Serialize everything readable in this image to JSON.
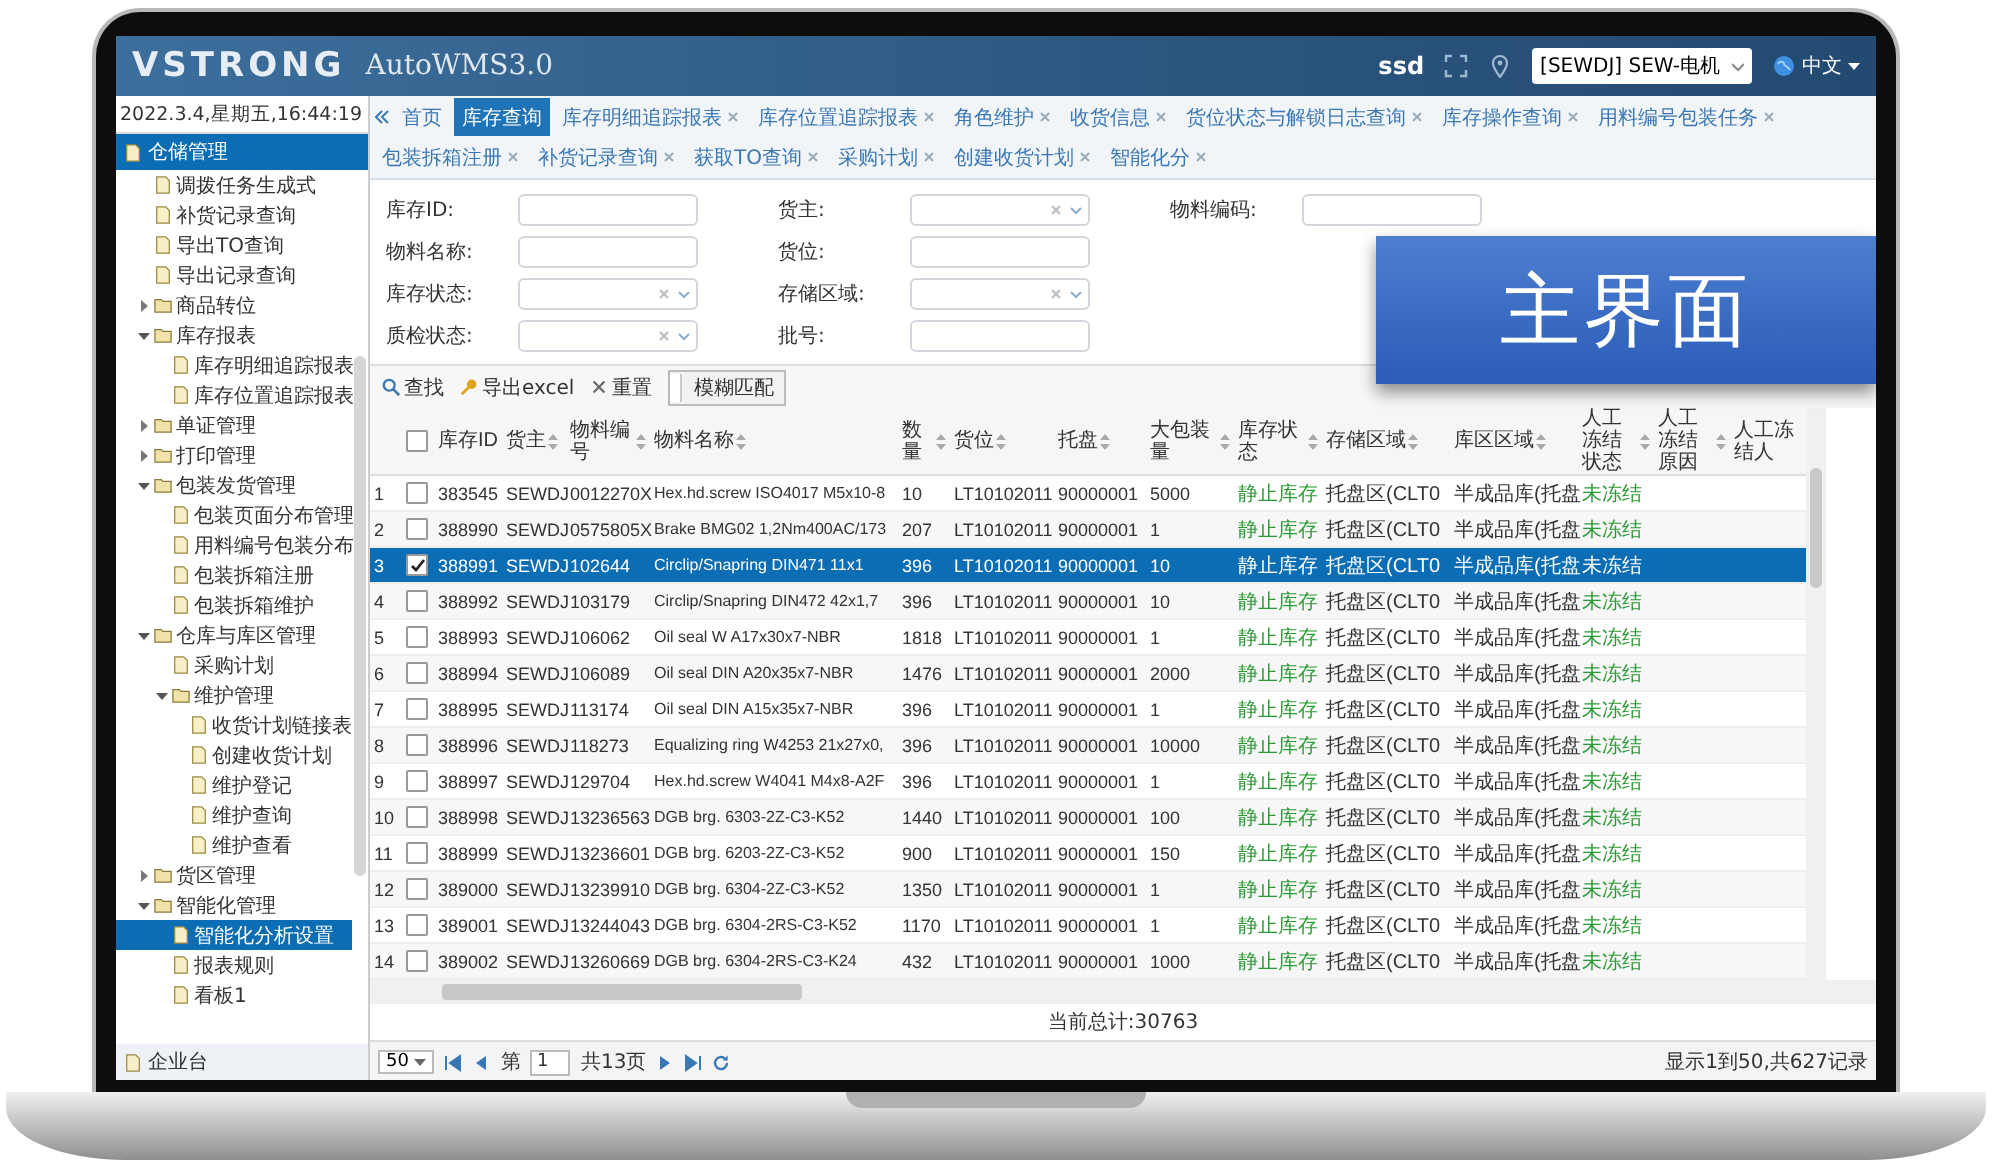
{
  "header": {
    "logo": "VSTRONG",
    "title": "AutoWMS3.0",
    "user": "ssd",
    "warehouse": "[SEWDJ] SEW-电机",
    "language": "中文"
  },
  "sidebar": {
    "datetime": "2022.3.4,星期五,16:44:19",
    "sections": [
      {
        "label": "仓储管理",
        "expanded": true,
        "items": [
          {
            "label": "调拨任务生成式",
            "kind": "leaf",
            "selected": false
          },
          {
            "label": "补货记录查询",
            "kind": "leaf",
            "selected": false
          },
          {
            "label": "导出TO查询",
            "kind": "leaf",
            "selected": false
          },
          {
            "label": "导出记录查询",
            "kind": "leaf",
            "selected": false
          },
          {
            "label": "商品转位",
            "kind": "group",
            "expanded": false,
            "selected": false
          },
          {
            "label": "库存报表",
            "kind": "group",
            "expanded": true,
            "selected": false,
            "children": [
              {
                "label": "库存明细追踪报表",
                "kind": "leaf",
                "selected": false
              },
              {
                "label": "库存位置追踪报表",
                "kind": "leaf",
                "selected": false
              }
            ]
          },
          {
            "label": "单证管理",
            "kind": "group",
            "expanded": false,
            "selected": false
          },
          {
            "label": "打印管理",
            "kind": "group",
            "expanded": false,
            "selected": false
          },
          {
            "label": "包装发货管理",
            "kind": "group",
            "expanded": true,
            "selected": false,
            "children": [
              {
                "label": "包装页面分布管理",
                "kind": "leaf",
                "selected": false
              },
              {
                "label": "用料编号包装分布",
                "kind": "leaf",
                "selected": false
              },
              {
                "label": "包装拆箱注册",
                "kind": "leaf",
                "selected": false
              },
              {
                "label": "包装拆箱维护",
                "kind": "leaf",
                "selected": false
              }
            ]
          },
          {
            "label": "仓库与库区管理",
            "kind": "group",
            "expanded": true,
            "selected": false,
            "children": [
              {
                "label": "采购计划",
                "kind": "leaf",
                "selected": false
              },
              {
                "label": "维护管理",
                "kind": "group",
                "expanded": true,
                "selected": false,
                "children": [
                  {
                    "label": "收货计划链接表",
                    "kind": "leaf",
                    "selected": false
                  },
                  {
                    "label": "创建收货计划",
                    "kind": "leaf",
                    "selected": false
                  },
                  {
                    "label": "维护登记",
                    "kind": "leaf",
                    "selected": false
                  },
                  {
                    "label": "维护查询",
                    "kind": "leaf",
                    "selected": false
                  },
                  {
                    "label": "维护查看",
                    "kind": "leaf",
                    "selected": false
                  }
                ]
              }
            ]
          },
          {
            "label": "货区管理",
            "kind": "group",
            "expanded": false,
            "selected": false
          },
          {
            "label": "智能化管理",
            "kind": "group",
            "expanded": true,
            "selected": false,
            "children": [
              {
                "label": "智能化分析设置",
                "kind": "leaf",
                "selected": true
              },
              {
                "label": "报表规则",
                "kind": "leaf",
                "selected": false
              },
              {
                "label": "看板1",
                "kind": "leaf",
                "selected": false
              }
            ]
          }
        ]
      },
      {
        "label": "企业台",
        "expanded": false
      }
    ]
  },
  "tabs": [
    {
      "label": "首页",
      "selected": false
    },
    {
      "label": "库存查询",
      "selected": true
    },
    {
      "label": "库存明细追踪报表",
      "selected": false
    },
    {
      "label": "库存位置追踪报表",
      "selected": false
    },
    {
      "label": "角色维护",
      "selected": false
    },
    {
      "label": "收货信息",
      "selected": false
    },
    {
      "label": "货位状态与解锁日志查询",
      "selected": false
    },
    {
      "label": "库存操作查询",
      "selected": false
    },
    {
      "label": "用料编号包装任务",
      "selected": false
    },
    {
      "label": "包装拆箱注册",
      "selected": false
    },
    {
      "label": "补货记录查询",
      "selected": false
    },
    {
      "label": "获取TO查询",
      "selected": false
    },
    {
      "label": "采购计划",
      "selected": false
    },
    {
      "label": "创建收货计划",
      "selected": false
    },
    {
      "label": "智能化分",
      "selected": false
    }
  ],
  "form": {
    "columns": [
      [
        {
          "label": "库存ID:",
          "kind": "text"
        },
        {
          "label": "物料名称:",
          "kind": "text"
        },
        {
          "label": "库存状态:",
          "kind": "select"
        },
        {
          "label": "质检状态:",
          "kind": "select"
        }
      ],
      [
        {
          "label": "货主:",
          "kind": "select"
        },
        {
          "label": "货位:",
          "kind": "text"
        },
        {
          "label": "存储区域:",
          "kind": "select"
        },
        {
          "label": "批号:",
          "kind": "text"
        }
      ],
      [
        {
          "label": "物料编码:",
          "kind": "text"
        }
      ]
    ]
  },
  "banner": {
    "text": "主界面"
  },
  "toolbar": [
    {
      "label": "查找",
      "kind": "search"
    },
    {
      "label": "导出excel",
      "kind": "export"
    },
    {
      "label": "重置",
      "kind": "reset"
    },
    {
      "label": "模糊匹配",
      "kind": "toggle"
    }
  ],
  "table": {
    "select_all_checked": false,
    "columns": [
      {
        "label": "库存ID",
        "kind": "text",
        "sortable": false
      },
      {
        "label": "货主",
        "kind": "text",
        "sortable": true
      },
      {
        "label": "物料编号",
        "kind": "text",
        "sortable": true
      },
      {
        "label": "物料名称",
        "kind": "name",
        "sortable": true
      },
      {
        "label": "数量",
        "kind": "text",
        "sortable": true
      },
      {
        "label": "货位",
        "kind": "text",
        "sortable": true
      },
      {
        "label": "托盘",
        "kind": "text",
        "sortable": true
      },
      {
        "label": "大包装量",
        "kind": "text",
        "sortable": true
      },
      {
        "label": "库存状态",
        "kind": "status",
        "sortable": true
      },
      {
        "label": "存储区域",
        "kind": "area",
        "sortable": true
      },
      {
        "label": "库区区域",
        "kind": "area",
        "sortable": true
      },
      {
        "label": "人工冻结状态",
        "kind": "status",
        "sortable": true
      },
      {
        "label": "人工冻结原因",
        "kind": "text",
        "sortable": true
      },
      {
        "label": "人工冻结人",
        "kind": "text",
        "sortable": false
      }
    ],
    "rows": [
      {
        "number": "1",
        "selected": false,
        "checked": false,
        "cells": [
          "383545",
          "SEWDJ",
          "0012270X",
          "Hex.hd.screw ISO4017 M5x10-8",
          "10",
          "LT10102011",
          "90000001",
          "5000",
          "静止库存",
          "托盘区(CLT0",
          "半成品库(托盘",
          "未冻结"
        ]
      },
      {
        "number": "2",
        "selected": false,
        "checked": false,
        "cells": [
          "388990",
          "SEWDJ",
          "0575805X",
          "Brake BMG02 1,2Nm400AC/173",
          "207",
          "LT10102011",
          "90000001",
          "1",
          "静止库存",
          "托盘区(CLT0",
          "半成品库(托盘",
          "未冻结"
        ]
      },
      {
        "number": "3",
        "selected": true,
        "checked": true,
        "cells": [
          "388991",
          "SEWDJ",
          "102644",
          "Circlip/Snapring DIN471 11x1",
          "396",
          "LT10102011",
          "90000001",
          "10",
          "静止库存",
          "托盘区(CLT0",
          "半成品库(托盘",
          "未冻结"
        ]
      },
      {
        "number": "4",
        "selected": false,
        "checked": false,
        "cells": [
          "388992",
          "SEWDJ",
          "103179",
          "Circlip/Snapring DIN472 42x1,7",
          "396",
          "LT10102011",
          "90000001",
          "10",
          "静止库存",
          "托盘区(CLT0",
          "半成品库(托盘",
          "未冻结"
        ]
      },
      {
        "number": "5",
        "selected": false,
        "checked": false,
        "cells": [
          "388993",
          "SEWDJ",
          "106062",
          "Oil seal W A17x30x7-NBR",
          "1818",
          "LT10102011",
          "90000001",
          "1",
          "静止库存",
          "托盘区(CLT0",
          "半成品库(托盘",
          "未冻结"
        ]
      },
      {
        "number": "6",
        "selected": false,
        "checked": false,
        "cells": [
          "388994",
          "SEWDJ",
          "106089",
          "Oil seal DIN A20x35x7-NBR",
          "1476",
          "LT10102011",
          "90000001",
          "2000",
          "静止库存",
          "托盘区(CLT0",
          "半成品库(托盘",
          "未冻结"
        ]
      },
      {
        "number": "7",
        "selected": false,
        "checked": false,
        "cells": [
          "388995",
          "SEWDJ",
          "113174",
          "Oil seal DIN A15x35x7-NBR",
          "396",
          "LT10102011",
          "90000001",
          "1",
          "静止库存",
          "托盘区(CLT0",
          "半成品库(托盘",
          "未冻结"
        ]
      },
      {
        "number": "8",
        "selected": false,
        "checked": false,
        "cells": [
          "388996",
          "SEWDJ",
          "118273",
          "Equalizing ring W4253 21x27x0,",
          "396",
          "LT10102011",
          "90000001",
          "10000",
          "静止库存",
          "托盘区(CLT0",
          "半成品库(托盘",
          "未冻结"
        ]
      },
      {
        "number": "9",
        "selected": false,
        "checked": false,
        "cells": [
          "388997",
          "SEWDJ",
          "129704",
          "Hex.hd.screw W4041 M4x8-A2F",
          "396",
          "LT10102011",
          "90000001",
          "1",
          "静止库存",
          "托盘区(CLT0",
          "半成品库(托盘",
          "未冻结"
        ]
      },
      {
        "number": "10",
        "selected": false,
        "checked": false,
        "cells": [
          "388998",
          "SEWDJ",
          "13236563",
          "DGB brg. 6303-2Z-C3-K52",
          "1440",
          "LT10102011",
          "90000001",
          "100",
          "静止库存",
          "托盘区(CLT0",
          "半成品库(托盘",
          "未冻结"
        ]
      },
      {
        "number": "11",
        "selected": false,
        "checked": false,
        "cells": [
          "388999",
          "SEWDJ",
          "13236601",
          "DGB brg. 6203-2Z-C3-K52",
          "900",
          "LT10102011",
          "90000001",
          "150",
          "静止库存",
          "托盘区(CLT0",
          "半成品库(托盘",
          "未冻结"
        ]
      },
      {
        "number": "12",
        "selected": false,
        "checked": false,
        "cells": [
          "389000",
          "SEWDJ",
          "13239910",
          "DGB brg. 6304-2Z-C3-K52",
          "1350",
          "LT10102011",
          "90000001",
          "1",
          "静止库存",
          "托盘区(CLT0",
          "半成品库(托盘",
          "未冻结"
        ]
      },
      {
        "number": "13",
        "selected": false,
        "checked": false,
        "cells": [
          "389001",
          "SEWDJ",
          "13244043",
          "DGB brg. 6304-2RS-C3-K52",
          "1170",
          "LT10102011",
          "90000001",
          "1",
          "静止库存",
          "托盘区(CLT0",
          "半成品库(托盘",
          "未冻结"
        ]
      },
      {
        "number": "14",
        "selected": false,
        "checked": false,
        "cells": [
          "389002",
          "SEWDJ",
          "13260669",
          "DGB brg. 6304-2RS-C3-K24",
          "432",
          "LT10102011",
          "90000001",
          "1000",
          "静止库存",
          "托盘区(CLT0",
          "半成品库(托盘",
          "未冻结"
        ]
      }
    ],
    "total": "当前总计:30763"
  },
  "pager": {
    "page_size": "50",
    "page_label": "第",
    "page": "1",
    "pages": "共13页",
    "summary": "显示1到50,共627记录"
  }
}
